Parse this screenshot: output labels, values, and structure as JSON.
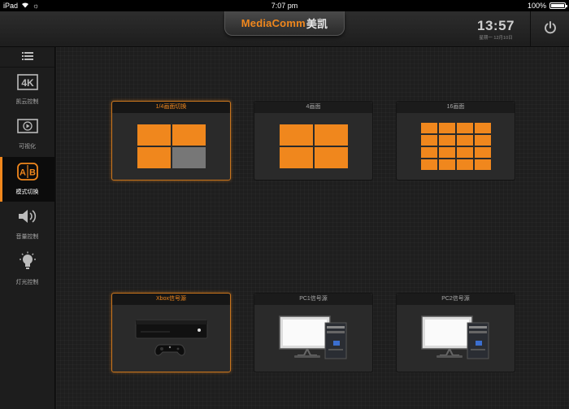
{
  "statusbar": {
    "device": "iPad",
    "time": "7:07 pm",
    "battery": "100%"
  },
  "header": {
    "brand_primary": "MediaComm",
    "brand_secondary": "美凯",
    "clock_time": "13:57",
    "clock_date": "星期一 12月10日"
  },
  "sidebar": {
    "items": [
      {
        "label": "凯云控制",
        "icon": "4k-icon",
        "active": false
      },
      {
        "label": "可视化",
        "icon": "play-screen-icon",
        "active": false
      },
      {
        "label": "模式切换",
        "icon": "ab-switch-icon",
        "active": true
      },
      {
        "label": "音量控制",
        "icon": "speaker-icon",
        "active": false
      },
      {
        "label": "灯光控制",
        "icon": "lightbulb-icon",
        "active": false
      }
    ]
  },
  "modes": [
    {
      "title": "1/4画面切换",
      "cols": 2,
      "rows": 2,
      "selected": true
    },
    {
      "title": "4画面",
      "cols": 2,
      "rows": 2,
      "selected": false
    },
    {
      "title": "16画面",
      "cols": 4,
      "rows": 4,
      "selected": false
    }
  ],
  "sources": [
    {
      "title": "Xbox信号源",
      "icon": "xbox-console-icon",
      "selected": true
    },
    {
      "title": "PC1信号源",
      "icon": "desktop-pc-icon",
      "selected": false
    },
    {
      "title": "PC2信号源",
      "icon": "desktop-pc-icon",
      "selected": false
    }
  ],
  "colors": {
    "accent": "#f0871d",
    "inactive_cell": "#777777",
    "background": "#1e1e1e"
  }
}
